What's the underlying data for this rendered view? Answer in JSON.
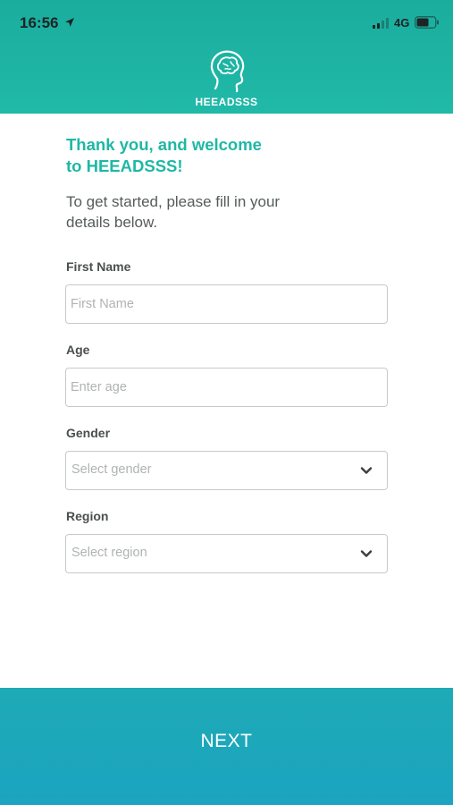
{
  "status_bar": {
    "time": "16:56",
    "network": "4G"
  },
  "header": {
    "brand": "HEEADSSS",
    "logo_icon": "brain-head-icon"
  },
  "welcome": {
    "line1": "Thank you, and welcome",
    "line2": "to HEEADSSS!"
  },
  "intro": {
    "line1": "To get started, please fill in your",
    "line2": "details below."
  },
  "form": {
    "first_name": {
      "label": "First Name",
      "placeholder": "First Name",
      "value": ""
    },
    "age": {
      "label": "Age",
      "placeholder": "Enter age",
      "value": ""
    },
    "gender": {
      "label": "Gender",
      "placeholder": "Select gender"
    },
    "region": {
      "label": "Region",
      "placeholder": "Select region"
    }
  },
  "footer": {
    "next_label": "NEXT"
  },
  "colors": {
    "header": "#1fb3a3",
    "accent_text": "#1fb8a4",
    "next_bar": "#1ca8bb"
  }
}
